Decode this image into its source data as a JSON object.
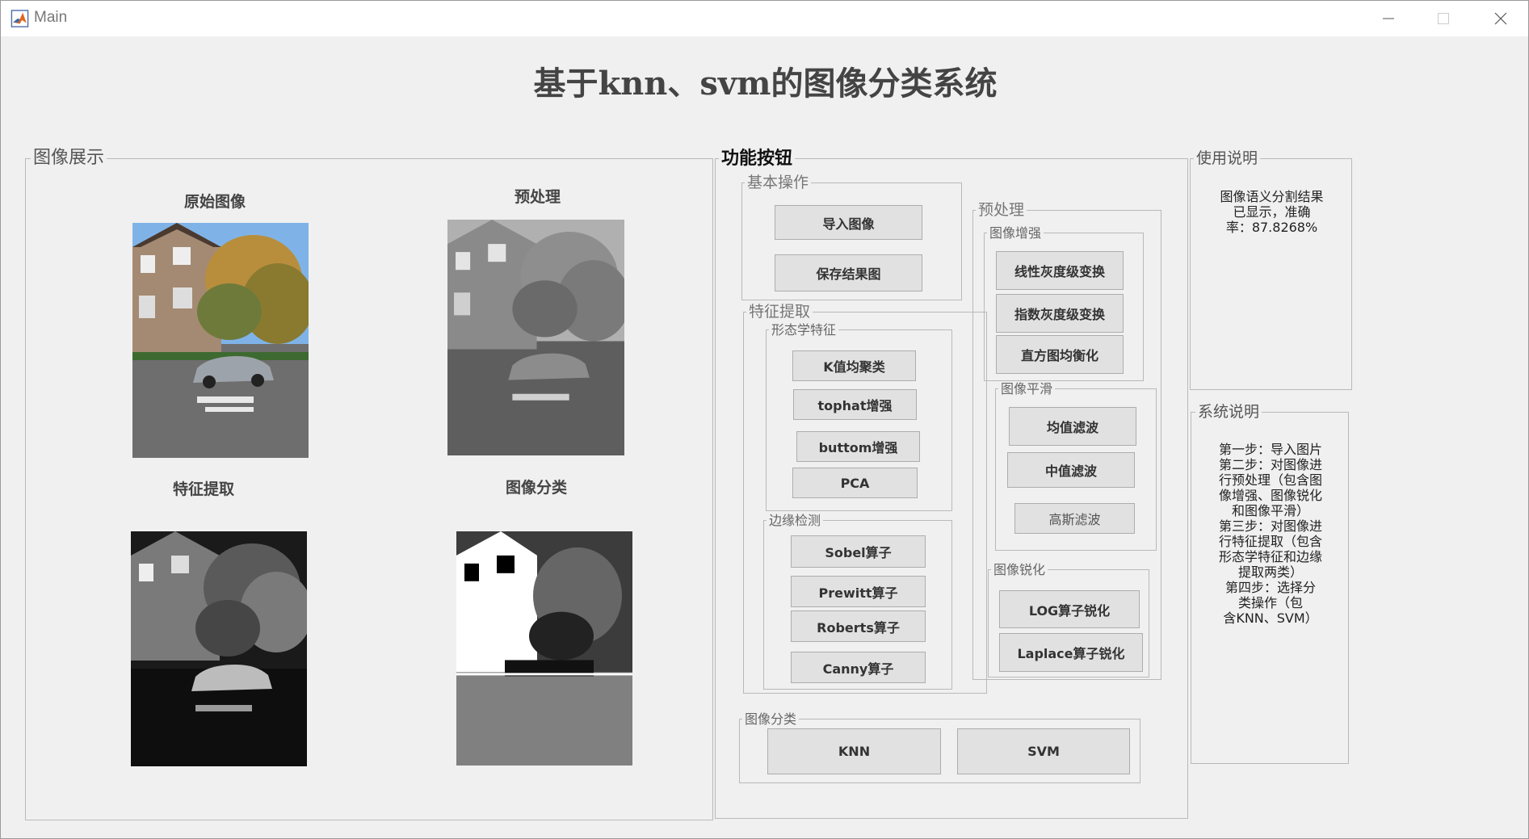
{
  "window": {
    "title": "Main"
  },
  "header": {
    "title": "基于knn、svm的图像分类系统"
  },
  "image_panel": {
    "title": "图像展示",
    "captions": {
      "original": "原始图像",
      "preprocess": "预处理",
      "feature": "特征提取",
      "classify": "图像分类"
    }
  },
  "func_panel": {
    "title": "功能按钮",
    "basic": {
      "title": "基本操作",
      "import": "导入图像",
      "save": "保存结果图"
    },
    "feature": {
      "title": "特征提取",
      "morph": {
        "title": "形态学特征",
        "kmeans": "K值均聚类",
        "tophat": "tophat增强",
        "bottom": "buttom增强",
        "pca": "PCA"
      },
      "edge": {
        "title": "边缘检测",
        "sobel": "Sobel算子",
        "prewitt": "Prewitt算子",
        "roberts": "Roberts算子",
        "canny": "Canny算子"
      }
    },
    "preprocess": {
      "title": "预处理",
      "enhance": {
        "title": "图像增强",
        "linear": "线性灰度级变换",
        "exp": "指数灰度级变换",
        "hist": "直方图均衡化"
      },
      "smooth": {
        "title": "图像平滑",
        "mean": "均值滤波",
        "median": "中值滤波",
        "gauss": "高斯滤波"
      },
      "sharpen": {
        "title": "图像锐化",
        "log": "LOG算子锐化",
        "laplace": "Laplace算子锐化"
      }
    },
    "classify": {
      "title": "图像分类",
      "knn": "KNN",
      "svm": "SVM"
    }
  },
  "usage_panel": {
    "title": "使用说明",
    "text": "图像语义分割结果\n已显示，准确\n率：87.8268%"
  },
  "system_panel": {
    "title": "系统说明",
    "text": "第一步：导入图片\n第二步：对图像进\n行预处理（包含图\n像增强、图像锐化\n和图像平滑）\n第三步：对图像进\n行特征提取（包含\n形态学特征和边缘\n提取两类）\n第四步：选择分\n类操作（包\n含KNN、SVM）"
  }
}
